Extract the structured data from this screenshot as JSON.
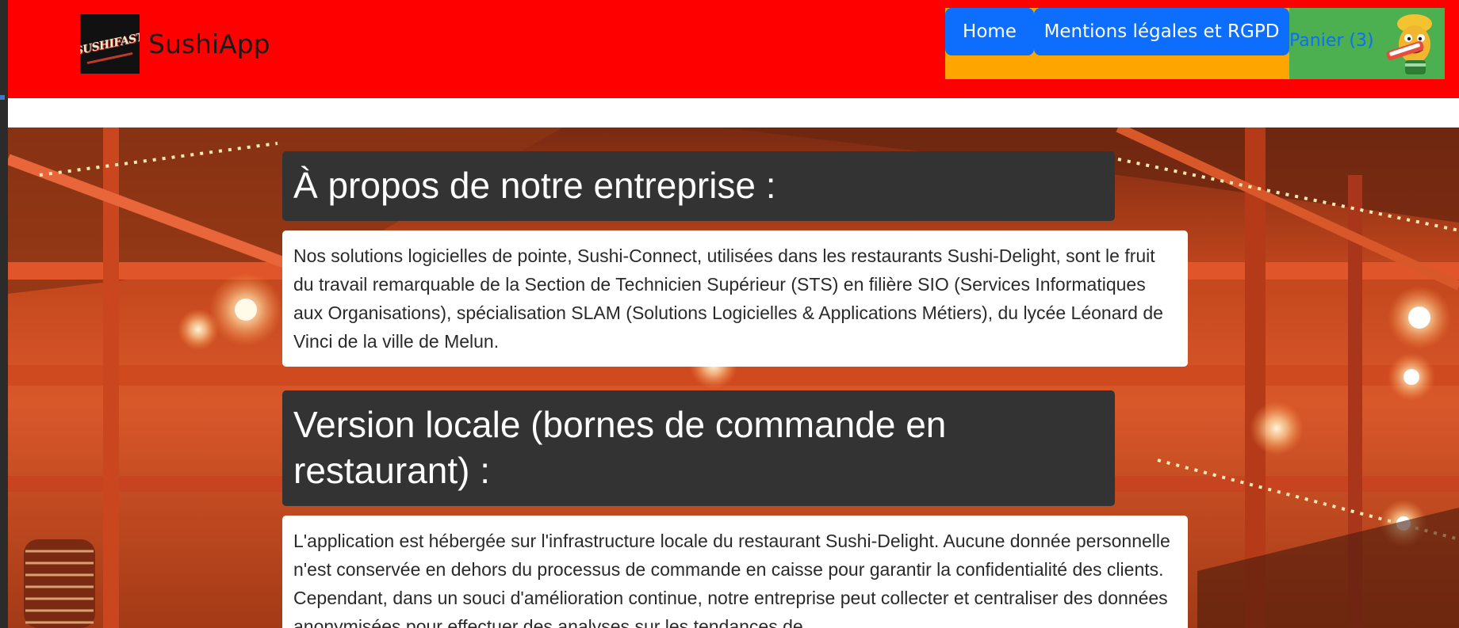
{
  "header": {
    "brand_name": "SushiApp",
    "logo_text": "SUSHIFAST",
    "background_color": "#ff0000",
    "nav": {
      "home_label": "Home",
      "mentions_label": "Mentions légales et RGPD",
      "cart_label": "Panier (3)"
    }
  },
  "sections": [
    {
      "title": "À propos de notre entreprise :",
      "text": "Nos solutions logicielles de pointe, Sushi-Connect, utilisées dans les restaurants Sushi-Delight, sont le fruit du travail remarquable de la Section de Technicien Supérieur (STS) en filière SIO (Services Informatiques aux Organisations), spécialisation SLAM (Solutions Logicielles & Applications Métiers), du lycée Léonard de Vinci de la ville de Melun."
    },
    {
      "title": "Version locale (bornes de commande en restaurant) :",
      "text": "L'application est hébergée sur l'infrastructure locale du restaurant Sushi-Delight. Aucune donnée personnelle n'est conservée en dehors du processus de commande en caisse pour garantir la confidentialité des clients. Cependant, dans un souci d'amélioration continue, notre entreprise peut collecter et centraliser des données anonymisées pour effectuer des analyses sur les tendances de"
    }
  ],
  "colors": {
    "nav_orange": "#ffa500",
    "nav_green": "#4caf50",
    "button_blue": "#0d6efd",
    "heading_bg": "#333333"
  },
  "icons": {
    "logo": "sushifast-logo",
    "cart_mascot": "sushi-mascot-icon"
  }
}
